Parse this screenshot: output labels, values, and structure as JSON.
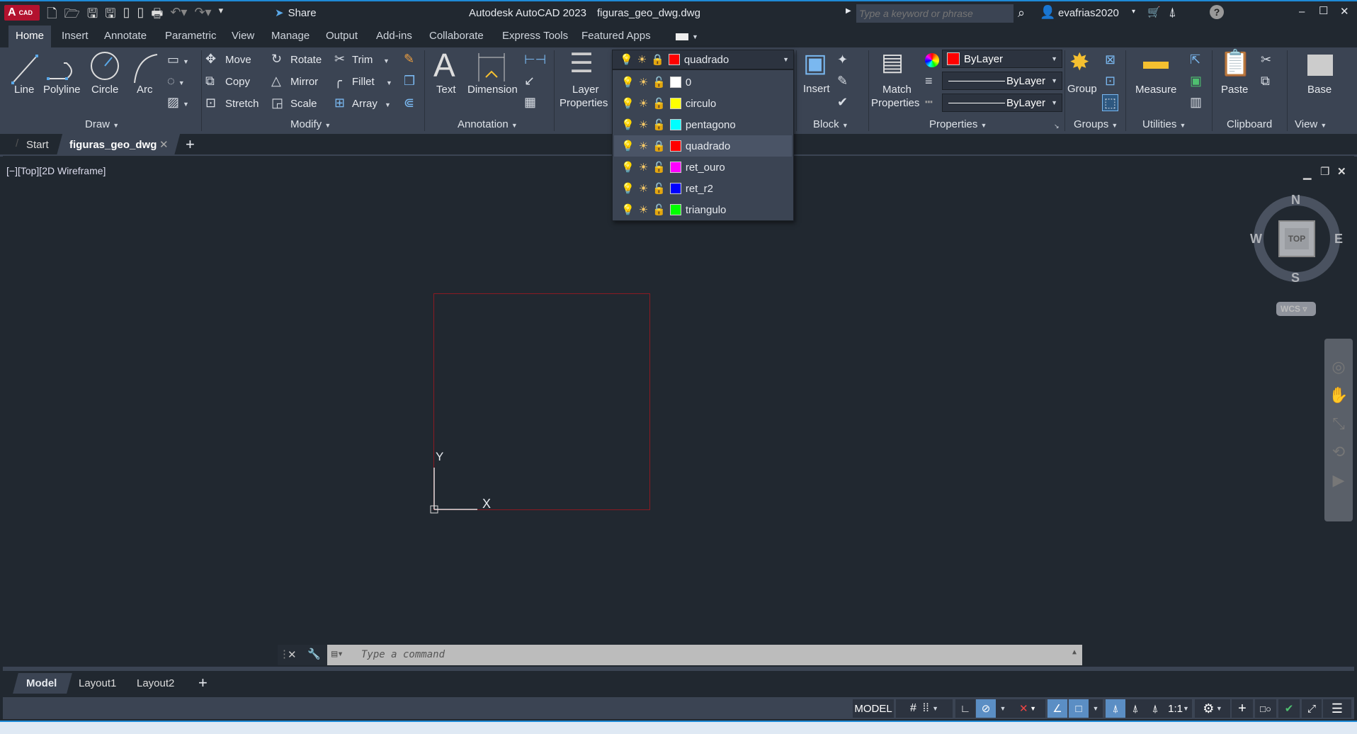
{
  "app": {
    "logo": "A",
    "logo_sub": "CAD",
    "title": "Autodesk AutoCAD 2023",
    "file": "figuras_geo_dwg.dwg",
    "share": "Share",
    "search_placeholder": "Type a keyword or phrase",
    "user": "evafrias2020"
  },
  "menu": [
    "Home",
    "Insert",
    "Annotate",
    "Parametric",
    "View",
    "Manage",
    "Output",
    "Add-ins",
    "Collaborate",
    "Express Tools",
    "Featured Apps"
  ],
  "ribbon": {
    "draw": {
      "label": "Draw",
      "items": [
        "Line",
        "Polyline",
        "Circle",
        "Arc"
      ]
    },
    "modify": {
      "label": "Modify",
      "items": [
        "Move",
        "Rotate",
        "Trim",
        "Copy",
        "Mirror",
        "Fillet",
        "Stretch",
        "Scale",
        "Array"
      ]
    },
    "annotation": {
      "label": "Annotation",
      "items": [
        "Text",
        "Dimension"
      ]
    },
    "layers": {
      "layer_properties_1": "Layer",
      "layer_properties_2": "Properties",
      "current_layer": "quadrado"
    },
    "block": {
      "label": "Block",
      "insert": "Insert"
    },
    "properties": {
      "label": "Properties",
      "match_1": "Match",
      "match_2": "Properties",
      "color": "ByLayer",
      "linetype": "ByLayer",
      "lineweight": "ByLayer"
    },
    "groups": {
      "label": "Groups",
      "group": "Group"
    },
    "utilities": {
      "label": "Utilities",
      "measure": "Measure"
    },
    "clipboard": {
      "label": "Clipboard",
      "paste": "Paste"
    },
    "view": {
      "label": "View",
      "base": "Base"
    }
  },
  "layers": [
    {
      "name": "0",
      "color": "#ffffff",
      "locked": false
    },
    {
      "name": "circulo",
      "color": "#ffff00",
      "locked": false
    },
    {
      "name": "pentagono",
      "color": "#00ffff",
      "locked": false
    },
    {
      "name": "quadrado",
      "color": "#ff0000",
      "locked": true,
      "selected": true
    },
    {
      "name": "ret_ouro",
      "color": "#ff00ff",
      "locked": false
    },
    {
      "name": "ret_r2",
      "color": "#0000ff",
      "locked": false
    },
    {
      "name": "triangulo",
      "color": "#00ff00",
      "locked": false
    }
  ],
  "doc_tabs": {
    "start": "Start",
    "active": "figuras_geo_dwg"
  },
  "viewport": {
    "label": "[−][Top][2D Wireframe]",
    "ucs_x": "X",
    "ucs_y": "Y",
    "rect_color": "#8b1a22"
  },
  "viewcube": {
    "n": "N",
    "s": "S",
    "e": "E",
    "w": "W",
    "top": "TOP",
    "wcs": "WCS"
  },
  "command": {
    "placeholder": "Type a command"
  },
  "layout_tabs": [
    "Model",
    "Layout1",
    "Layout2"
  ],
  "status": {
    "model": "MODEL",
    "scale": "1:1"
  }
}
